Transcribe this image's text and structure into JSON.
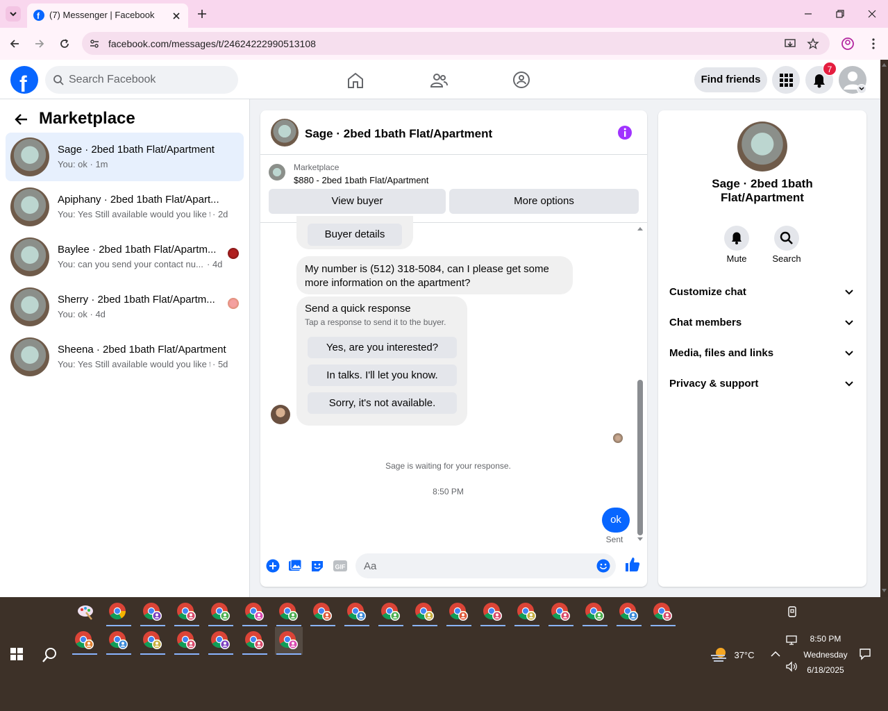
{
  "browser": {
    "tab_title": "(7) Messenger | Facebook",
    "url": "facebook.com/messages/t/24624222990513108"
  },
  "fb": {
    "search_placeholder": "Search Facebook",
    "find_friends": "Find friends",
    "notification_count": "7"
  },
  "left_panel": {
    "title": "Marketplace",
    "conversations": [
      {
        "name": "Sage · 2bed 1bath Flat/Apartment",
        "preview": "You: ok · 1m",
        "active": true
      },
      {
        "name": "Apiphany · 2bed 1bath Flat/Apart...",
        "preview": "You: Yes Still available would you like t...",
        "time": "· 2d"
      },
      {
        "name": "Baylee · 2bed 1bath Flat/Apartm...",
        "preview": "You: can you send your contact nu...",
        "time": "· 4d"
      },
      {
        "name": "Sherry · 2bed 1bath Flat/Apartm...",
        "preview": "You: ok · 4d"
      },
      {
        "name": "Sheena · 2bed 1bath Flat/Apartment",
        "preview": "You: Yes Still available would you like t...",
        "time": "· 5d"
      }
    ]
  },
  "chat": {
    "title": "Sage · 2bed 1bath Flat/Apartment",
    "marketplace_label": "Marketplace",
    "listing": "$880 - 2bed 1bath Flat/Apartment",
    "view_buyer": "View buyer",
    "more_options": "More options",
    "buyer_details": "Buyer details",
    "message_1": "My number is (512) 318-5084, can I please get some more information on the apartment?",
    "quick_title": "Send a quick response",
    "quick_sub": "Tap a response to send it to the buyer.",
    "quick_responses": [
      "Yes, are you interested?",
      "In talks. I'll let you know.",
      "Sorry, it's not available."
    ],
    "waiting": "Sage is waiting for your response.",
    "timestamp": "8:50 PM",
    "sent_message": "ok",
    "sent_status": "Sent",
    "composer_placeholder": "Aa"
  },
  "right_panel": {
    "name": "Sage · 2bed 1bath Flat/Apartment",
    "mute": "Mute",
    "search": "Search",
    "sections": [
      "Customize chat",
      "Chat members",
      "Media, files and links",
      "Privacy & support"
    ]
  },
  "taskbar": {
    "temperature": "37°C",
    "time": "8:50 PM",
    "day": "Wednesday",
    "date": "6/18/2025"
  },
  "colors": {
    "fb_blue": "#0866ff",
    "tab_strip": "#f9d7ee",
    "info_purple": "#a033ff"
  }
}
